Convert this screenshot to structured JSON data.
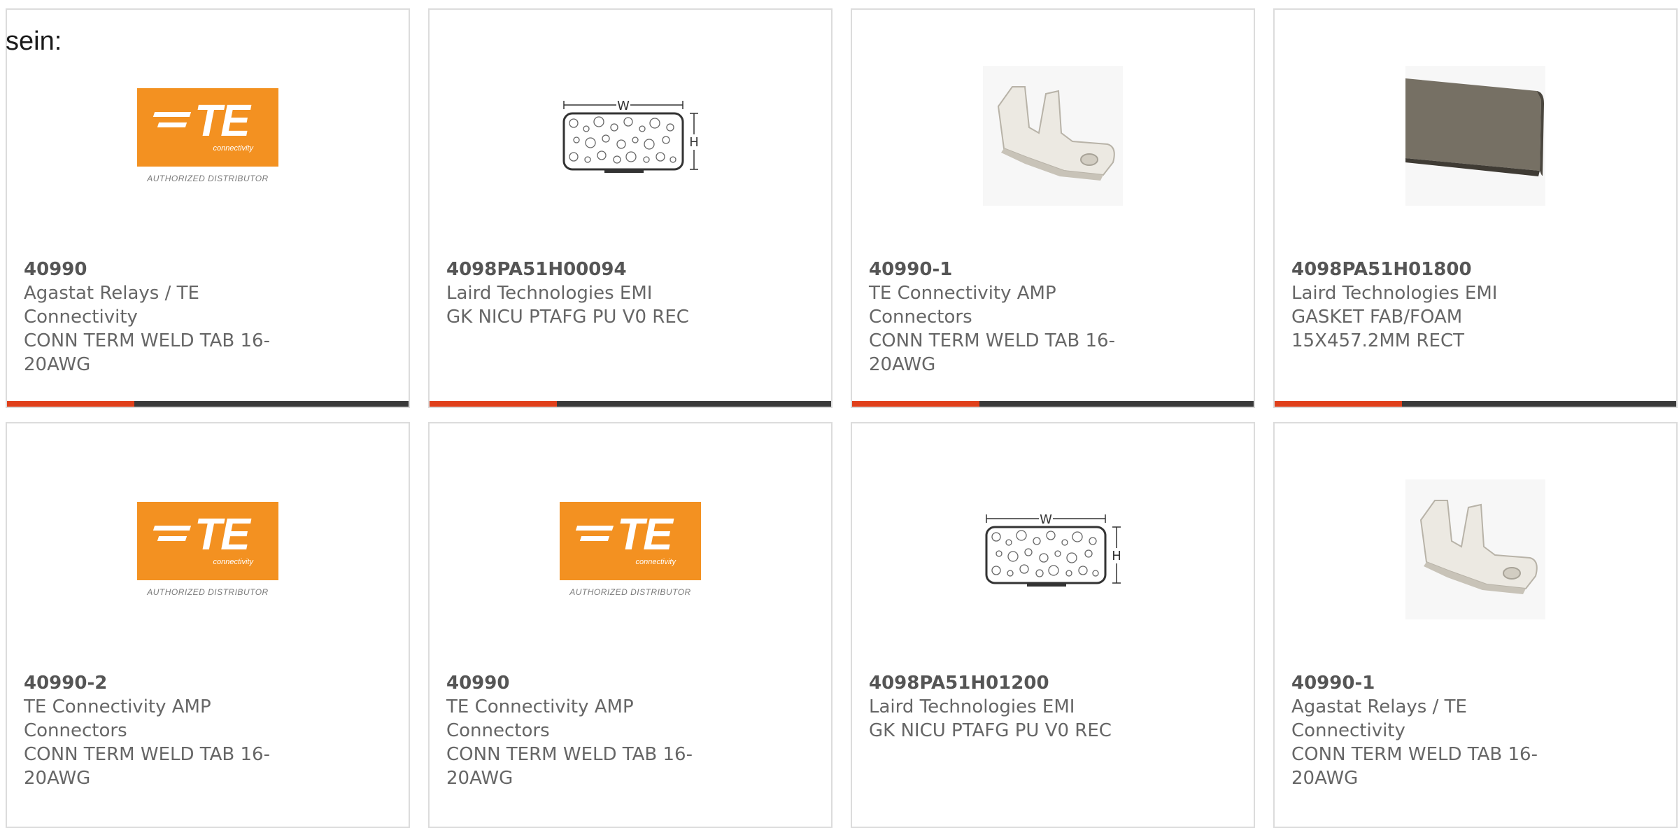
{
  "intro_text": "sein:",
  "products": [
    {
      "part_number": "40990",
      "manufacturer": "Agastat Relays / TE Connectivity",
      "description": "CONN TERM WELD TAB 16-20AWG",
      "image_icon": "te-authorized-distributor-logo",
      "te_text": "TE",
      "te_sub": "connectivity",
      "te_auth": "AUTHORIZED DISTRIBUTOR"
    },
    {
      "part_number": "4098PA51H00094",
      "manufacturer": "Laird Technologies EMI",
      "description": "GK NICU PTAFG PU V0 REC",
      "image_icon": "emi-gasket-drawing",
      "dim_w": "W",
      "dim_h": "H"
    },
    {
      "part_number": "40990-1",
      "manufacturer": "TE Connectivity AMP Connectors",
      "description": "CONN TERM WELD TAB 16-20AWG",
      "image_icon": "weld-tab-terminal-photo"
    },
    {
      "part_number": "4098PA51H01800",
      "manufacturer": "Laird Technologies EMI",
      "description": "GASKET FAB/FOAM 15X457.2MM RECT",
      "image_icon": "foam-gasket-photo"
    },
    {
      "part_number": "40990-2",
      "manufacturer": "TE Connectivity AMP Connectors",
      "description": "CONN TERM WELD TAB 16-20AWG",
      "image_icon": "te-authorized-distributor-logo",
      "te_text": "TE",
      "te_sub": "connectivity",
      "te_auth": "AUTHORIZED DISTRIBUTOR"
    },
    {
      "part_number": "40990",
      "manufacturer": "TE Connectivity AMP Connectors",
      "description": "CONN TERM WELD TAB 16-20AWG",
      "image_icon": "te-authorized-distributor-logo",
      "te_text": "TE",
      "te_sub": "connectivity",
      "te_auth": "AUTHORIZED DISTRIBUTOR"
    },
    {
      "part_number": "4098PA51H01200",
      "manufacturer": "Laird Technologies EMI",
      "description": "GK NICU PTAFG PU V0 REC",
      "image_icon": "emi-gasket-drawing",
      "dim_w": "W",
      "dim_h": "H"
    },
    {
      "part_number": "40990-1",
      "manufacturer": "Agastat Relays / TE Connectivity",
      "description": "CONN TERM WELD TAB 16-20AWG",
      "image_icon": "weld-tab-terminal-photo"
    }
  ],
  "colors": {
    "accent": "#e0401b",
    "bar": "#3a3a3a",
    "te_orange": "#f39121",
    "border": "#dcdcdc"
  }
}
